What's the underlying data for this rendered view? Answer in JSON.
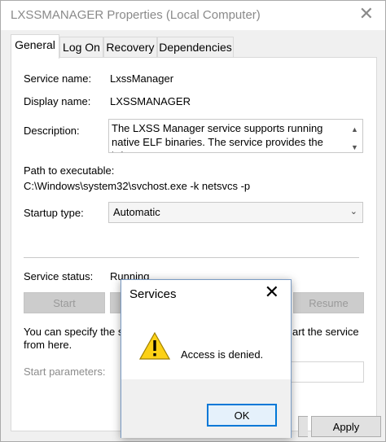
{
  "window": {
    "title": "LXSSMANAGER Properties (Local Computer)"
  },
  "tabs": [
    {
      "label": "General"
    },
    {
      "label": "Log On"
    },
    {
      "label": "Recovery"
    },
    {
      "label": "Dependencies"
    }
  ],
  "general": {
    "service_name_label": "Service name:",
    "service_name": "LxssManager",
    "display_name_label": "Display name:",
    "display_name": "LXSSMANAGER",
    "description_label": "Description:",
    "description": "The LXSS Manager service supports running native ELF binaries. The service provides the infrastructure",
    "path_label": "Path to executable:",
    "path": "C:\\Windows\\system32\\svchost.exe -k netsvcs -p",
    "startup_label": "Startup type:",
    "startup_value": "Automatic",
    "status_label": "Service status:",
    "status_value": "Running",
    "buttons": {
      "start": "Start",
      "resume": "Resume"
    },
    "hint_part1": "You can specify the st",
    "hint_part2": "art the service",
    "hint_line2": "from here.",
    "params_label": "Start parameters:"
  },
  "footer": {
    "apply": "Apply"
  },
  "dialog": {
    "title": "Services",
    "message": "Access is denied.",
    "ok": "OK"
  },
  "colors": {
    "accent": "#0078d7",
    "warning": "#fcd116"
  }
}
